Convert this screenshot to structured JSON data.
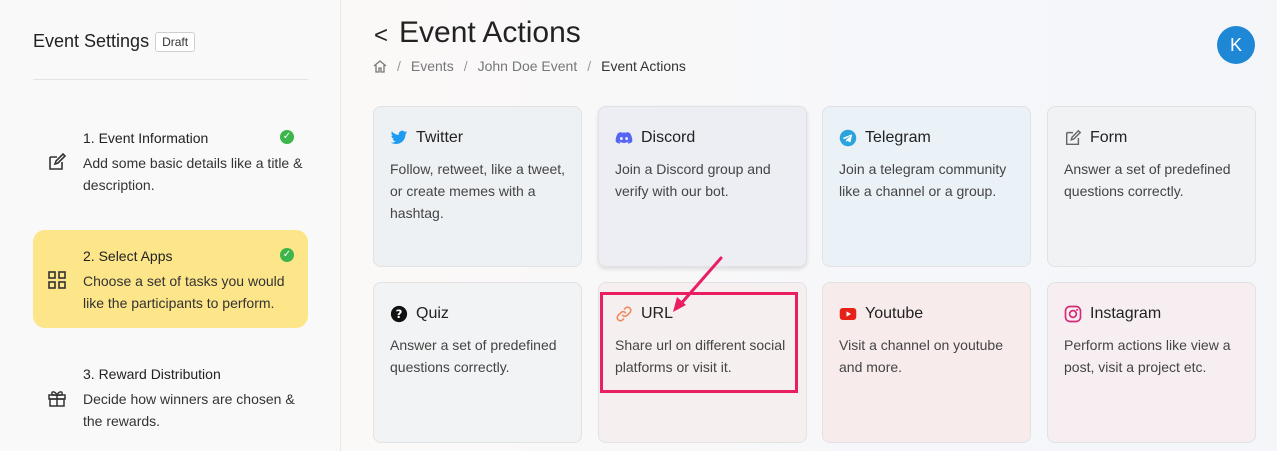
{
  "sidebar": {
    "title": "Event Settings",
    "badge": "Draft",
    "steps": [
      {
        "title": "1. Event Information",
        "desc": "Add some basic details like a title & description.",
        "completed": true,
        "icon": "edit-icon"
      },
      {
        "title": "2. Select Apps",
        "desc": "Choose a set of tasks you would like the participants to perform.",
        "completed": true,
        "icon": "grid-icon"
      },
      {
        "title": "3. Reward Distribution",
        "desc": "Decide how winners are chosen & the rewards.",
        "completed": false,
        "icon": "gift-icon"
      }
    ]
  },
  "header": {
    "back_glyph": "<",
    "title": "Event Actions",
    "breadcrumb": [
      "Events",
      "John Doe Event",
      "Event Actions"
    ],
    "avatar_initial": "K"
  },
  "cards": [
    {
      "title": "Twitter",
      "desc": "Follow, retweet, like a tweet, or create memes with a hashtag.",
      "icon": "twitter-icon"
    },
    {
      "title": "Discord",
      "desc": "Join a Discord group and verify with our bot.",
      "icon": "discord-icon"
    },
    {
      "title": "Telegram",
      "desc": "Join a telegram community like a channel or a group.",
      "icon": "telegram-icon"
    },
    {
      "title": "Form",
      "desc": "Answer a set of predefined questions correctly.",
      "icon": "form-icon"
    },
    {
      "title": "Quiz",
      "desc": "Answer a set of predefined questions correctly.",
      "icon": "quiz-icon"
    },
    {
      "title": "URL",
      "desc": "Share url on different social platforms or visit it.",
      "icon": "link-icon"
    },
    {
      "title": "Youtube",
      "desc": "Visit a channel on youtube and more.",
      "icon": "youtube-icon"
    },
    {
      "title": "Instagram",
      "desc": "Perform actions like view a post, visit a project etc.",
      "icon": "instagram-icon"
    }
  ],
  "colors": {
    "active_step": "#fde58a",
    "check": "#3cb54a",
    "avatar": "#1e88d6",
    "highlight": "#e91e63"
  }
}
